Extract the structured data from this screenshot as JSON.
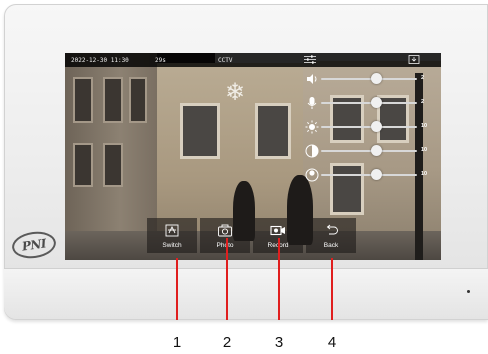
{
  "device": {
    "logo_text": "PNI"
  },
  "status_bar": {
    "datetime": "2022-12-30 11:30",
    "timer": "29s",
    "source": "CCTV",
    "icons": [
      "settings-sliders-icon",
      "exit-icon"
    ]
  },
  "sliders": [
    {
      "icon": "volume-icon",
      "value": "2",
      "level": 0.58
    },
    {
      "icon": "microphone-icon",
      "value": "2",
      "level": 0.58
    },
    {
      "icon": "brightness-icon",
      "value": "10",
      "level": 0.58
    },
    {
      "icon": "contrast-icon",
      "value": "10",
      "level": 0.58
    },
    {
      "icon": "color-saturation-icon",
      "value": "10",
      "level": 0.58
    }
  ],
  "buttons": [
    {
      "label": "Switch",
      "icon": "switch-camera-icon"
    },
    {
      "label": "Photo",
      "icon": "camera-icon"
    },
    {
      "label": "Record",
      "icon": "video-record-icon"
    },
    {
      "label": "Back",
      "icon": "back-arrow-icon"
    }
  ],
  "callouts": [
    "1",
    "2",
    "3",
    "4"
  ],
  "colors": {
    "callout": "#e01e1e",
    "button_bg": "rgba(30,28,26,0.62)",
    "status_bar_bg": "#000000"
  }
}
